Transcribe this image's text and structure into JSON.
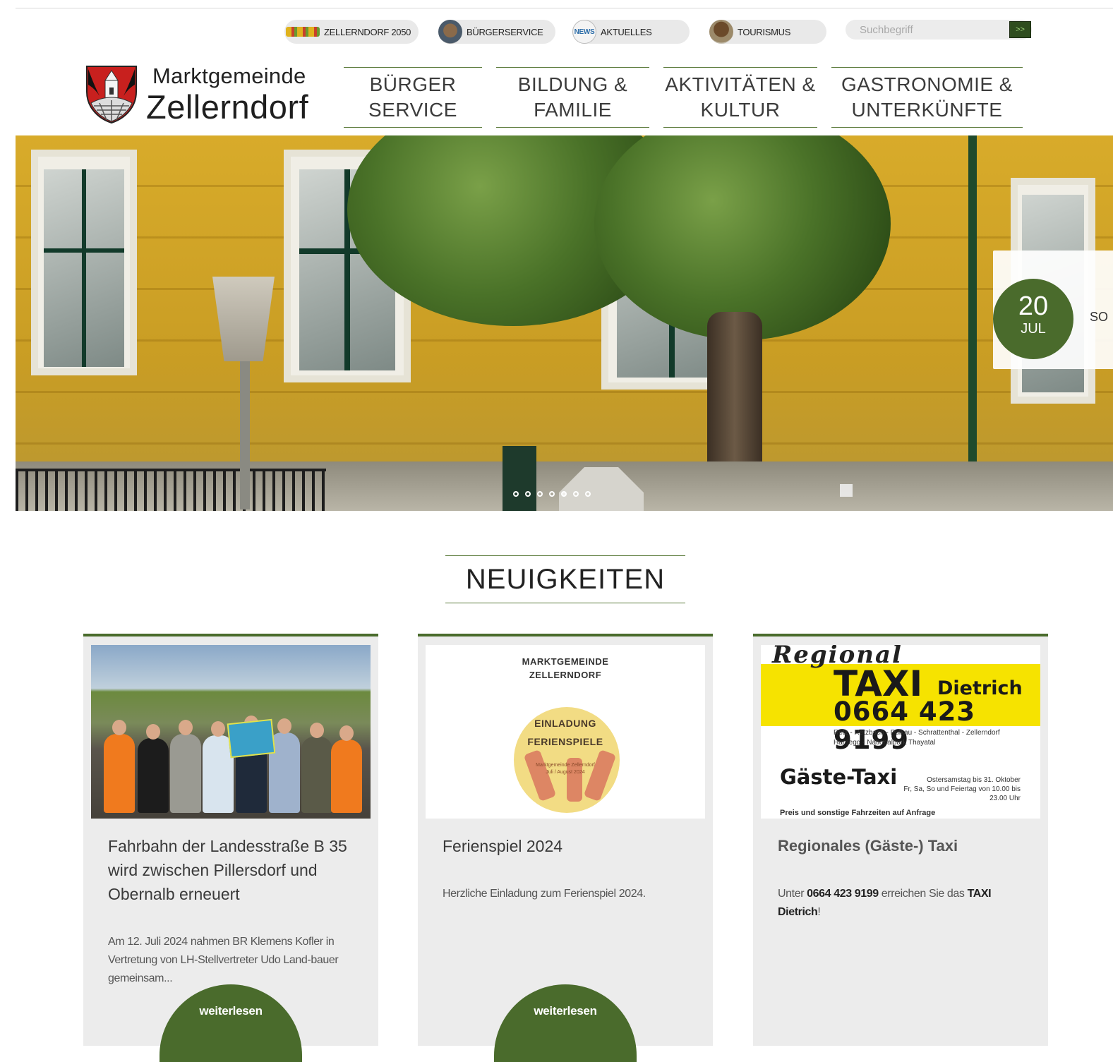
{
  "quicklinks": [
    {
      "label": "ZELLERNDORF 2050"
    },
    {
      "label": "BÜRGERSERVICE"
    },
    {
      "label": "AKTUELLES",
      "icon_text": "NEWS"
    },
    {
      "label": "TOURISMUS"
    }
  ],
  "search": {
    "placeholder": "Suchbegriff",
    "button": ">>"
  },
  "logo": {
    "line1": "Marktgemeinde",
    "line2": "Zellerndorf"
  },
  "nav": [
    {
      "l1": "BÜRGER",
      "l2": "SERVICE"
    },
    {
      "l1": "BILDUNG &",
      "l2": "FAMILIE"
    },
    {
      "l1": "AKTIVITÄTEN &",
      "l2": "KULTUR"
    },
    {
      "l1": "GASTRONOMIE &",
      "l2": "UNTERKÜNFTE"
    }
  ],
  "hero": {
    "slide_count": 7,
    "active_slide": 5,
    "event": {
      "day": "20",
      "month": "JUL",
      "text": "SO"
    }
  },
  "news": {
    "heading": "NEUIGKEITEN",
    "cards": [
      {
        "title": "Fahrbahn der Landesstraße B 35 wird zwischen Pillersdorf und Obernalb erneuert",
        "teaser": "Am 12. Juli 2024 nahmen BR Klemens Kofler in Vertretung von LH-Stellvertreter Udo Land-bauer gemeinsam...",
        "more": "weiterlesen"
      },
      {
        "title": "Ferienspiel 2024",
        "teaser": "Herzliche Einladung zum Ferienspiel 2024.",
        "more": "weiterlesen",
        "image": {
          "line1": "MARKTGEMEINDE",
          "line2": "ZELLERNDORF",
          "line3": "EINLADUNG",
          "line4": "FERIENSPIELE",
          "line5": "Marktgemeinde Zellerndorf",
          "line6": "Juli / August 2024"
        }
      },
      {
        "title": "Regionales (Gäste-) Taxi",
        "teaser_pre": "Unter ",
        "teaser_phone": "0664 423 9199",
        "teaser_mid": " erreichen Sie das ",
        "teaser_bold": "TAXI Dietrich",
        "teaser_post": "!",
        "image": {
          "regional": "Regional",
          "taxi": "TAXI",
          "name": "Dietrich",
          "phone": "0664 423 9199",
          "places1": "Retz - Retzbach - Pulkau - Schrattenthal - Zellerndorf",
          "places2": "Hardegg - Nationalpark Thayatal",
          "guest": "Gäste-Taxi",
          "season": "Ostersamstag bis 31. Oktober",
          "hours": "Fr, Sa, So und Feiertag von 10.00 bis 23.00 Uhr",
          "note": "Preis und sonstige Fahrzeiten auf Anfrage"
        }
      }
    ]
  },
  "colors": {
    "accent": "#4a6b2c",
    "card_bg": "#ececec",
    "search_button": "#2f4d1f"
  }
}
